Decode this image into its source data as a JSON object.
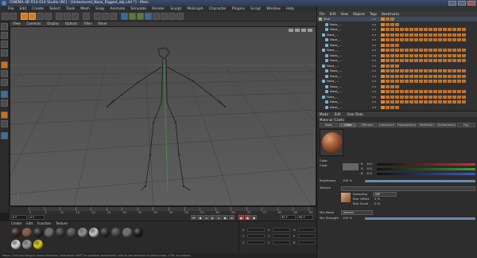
{
  "window": {
    "title": "CINEMA 4D R14.014 Studio (RC) - [Untextured_Naza_Rigged_obj.c4d *] - Main"
  },
  "menubar": {
    "items": [
      "File",
      "Edit",
      "Create",
      "Select",
      "Tools",
      "Mesh",
      "Snap",
      "Animate",
      "Simulate",
      "Render",
      "Sculpt",
      "MoGraph",
      "Character",
      "Plugins",
      "Script",
      "Window",
      "Help"
    ]
  },
  "viewport": {
    "menu": [
      "View",
      "Cameras",
      "Display",
      "Options",
      "Filter",
      "Panel"
    ]
  },
  "timeline": {
    "ticks": [
      "0",
      "5",
      "10",
      "15",
      "20",
      "25",
      "30",
      "35",
      "40",
      "45",
      "50",
      "55",
      "60",
      "65",
      "70",
      "75",
      "80",
      "85",
      "90"
    ]
  },
  "transport": {
    "start_frame": "0 F",
    "current_frame": "0 F",
    "end_frame": "90 F",
    "max_frame": "90 F"
  },
  "material_manager": {
    "menu": [
      "Create",
      "Edit",
      "Function",
      "Texture"
    ],
    "swatch_colors": [
      "#3a2a20",
      "#8a5a3a",
      "#2a2a2a",
      "#6a6a6a",
      "#3a3a3a",
      "#505050",
      "#8e8e8e",
      "#c8c8c8",
      "#2c2c2c",
      "#484848",
      "#707070",
      "#1c1c1c",
      "#d8d8d8",
      "#9a9a9a",
      "#e4d000"
    ]
  },
  "coordinates": {
    "labels": [
      "X",
      "Y",
      "Z",
      "X",
      "Y",
      "Z",
      "H",
      "P",
      "B"
    ]
  },
  "object_manager": {
    "menu": [
      "File",
      "Edit",
      "View",
      "Objects",
      "Tags",
      "Bookmarks"
    ],
    "rows": [
      {
        "name": "Skin",
        "selected": true
      },
      {
        "name": "Naza_...",
        "selected": false
      },
      {
        "name": "Naza_...",
        "selected": false
      },
      {
        "name": "Naza_...",
        "selected": false
      },
      {
        "name": "Naza_...",
        "selected": false
      },
      {
        "name": "Naza_...",
        "selected": false
      },
      {
        "name": "Naza_...",
        "selected": false
      },
      {
        "name": "Naza_...",
        "selected": false
      },
      {
        "name": "Naza_...",
        "selected": false
      },
      {
        "name": "Naza_...",
        "selected": false
      },
      {
        "name": "Naza_...",
        "selected": false
      },
      {
        "name": "Naza_...",
        "selected": false
      },
      {
        "name": "Naza_...",
        "selected": false
      },
      {
        "name": "Naza_...",
        "selected": false
      },
      {
        "name": "Naza_...",
        "selected": false
      },
      {
        "name": "Naza_...",
        "selected": false
      },
      {
        "name": "Naza_...",
        "selected": false
      },
      {
        "name": "Naza_...",
        "selected": false
      }
    ]
  },
  "attributes": {
    "menu": [
      "Mode",
      "Edit",
      "User Data"
    ],
    "title": "Material [Cloth]",
    "tabs": [
      "Basic",
      "Color",
      "Diffusion",
      "Luminance",
      "Transparency",
      "Reflection",
      "Environment",
      "Fog"
    ],
    "active_tab_index": 1,
    "section": "Color",
    "color_label": "Color",
    "brightness_label": "Brightness",
    "brightness_value": "100 %",
    "texture_label": "Texture",
    "mix_mode_label": "Mix Mode",
    "mix_mode_value": "Normal",
    "mix_strength_label": "Mix Strength",
    "mix_strength_value": "100 %",
    "sampling_label": "Sampling",
    "sampling_value": "MIP",
    "blur_offset_label": "Blur Offset",
    "blur_offset_value": "0 %",
    "blur_scale_label": "Blur Scale",
    "blur_scale_value": "0 %",
    "color_channels": {
      "r": 101,
      "g": 101,
      "b": 101
    },
    "colors": {
      "red": "#c83232",
      "green": "#3ca03c",
      "blue": "#3c5ac8"
    }
  },
  "statusbar": {
    "text": "Move: Click and drag to move elements. Hold down SHIFT to quantize movement / add to the selection in point mode, CTRL to remove."
  }
}
